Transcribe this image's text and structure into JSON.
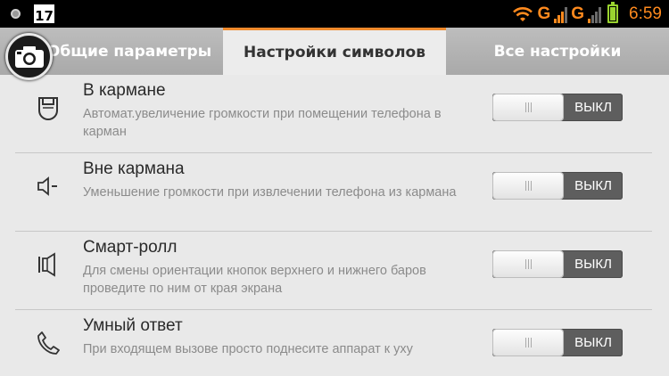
{
  "status_bar": {
    "calendar_day": "17",
    "network_1": "G",
    "network_2": "G",
    "time": "6:59",
    "accent_color": "#ff8a1e",
    "battery_color": "#9ad42f"
  },
  "tabs": [
    {
      "label": "Общие параметры"
    },
    {
      "label": "Настройки символов",
      "active": true
    },
    {
      "label": "Все настройки"
    }
  ],
  "tab_accent": "#f08a2c",
  "rows": [
    {
      "icon": "pocket-icon",
      "title": "В кармане",
      "description": "Автомат.увеличение громкости при помещении телефона в карман",
      "toggle": "ВЫКЛ"
    },
    {
      "icon": "speaker-minus-icon",
      "title": "Вне кармана",
      "description": "Уменьшение громкости при извлечении телефона из кармана",
      "toggle": "ВЫКЛ"
    },
    {
      "icon": "smart-roll-icon",
      "title": "Смарт-ролл",
      "description": "Для смены ориентации кнопок верхнего и нижнего баров проведите по ним от края экрана",
      "toggle": "ВЫКЛ"
    },
    {
      "icon": "phone-icon",
      "title": "Умный ответ",
      "description": "При входящем вызове просто поднесите аппарат к уху",
      "toggle": "ВЫКЛ"
    }
  ]
}
